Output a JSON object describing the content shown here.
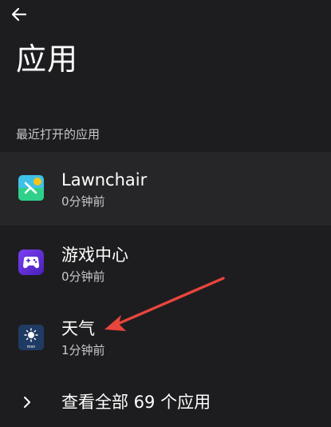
{
  "header": {
    "back_icon": "arrow-left-icon",
    "title": "应用"
  },
  "recent_section": {
    "label": "最近打开的应用",
    "items": [
      {
        "name": "Lawnchair",
        "time": "0分钟前",
        "icon": "lawnchair-app-icon"
      },
      {
        "name": "游戏中心",
        "time": "0分钟前",
        "icon": "game-center-app-icon"
      },
      {
        "name": "天气",
        "time": "1分钟前",
        "icon": "weather-app-icon",
        "icon_text": "msn"
      }
    ]
  },
  "see_all": {
    "label": "查看全部 69 个应用",
    "icon": "chevron-right-icon"
  },
  "colors": {
    "background": "#1d1d1f",
    "highlight_row": "#262628",
    "annotation_arrow": "#e8453c"
  }
}
